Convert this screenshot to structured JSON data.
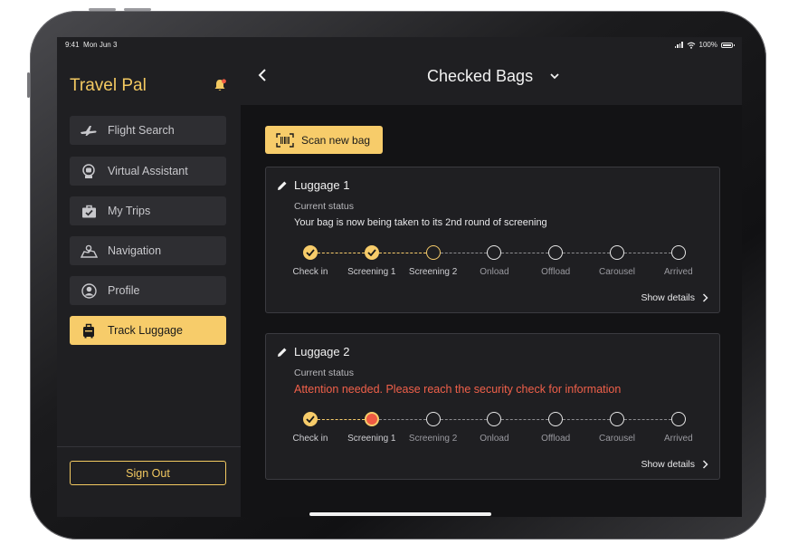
{
  "status_bar": {
    "time": "9:41",
    "date": "Mon Jun 3",
    "battery": "100%"
  },
  "sidebar": {
    "brand": "Travel Pal",
    "items": [
      {
        "label": "Flight Search",
        "icon": "airplane-icon",
        "active": false
      },
      {
        "label": "Virtual Assistant",
        "icon": "assistant-icon",
        "active": false
      },
      {
        "label": "My Trips",
        "icon": "briefcase-icon",
        "active": false
      },
      {
        "label": "Navigation",
        "icon": "map-icon",
        "active": false
      },
      {
        "label": "Profile",
        "icon": "user-icon",
        "active": false
      },
      {
        "label": "Track Luggage",
        "icon": "luggage-icon",
        "active": true
      }
    ],
    "sign_out": "Sign Out"
  },
  "header": {
    "title": "Checked Bags"
  },
  "scan_button": {
    "label": "Scan new bag"
  },
  "bags": [
    {
      "name": "Luggage 1",
      "status_label": "Current status",
      "message": "Your bag is now being taken to its 2nd round of screening",
      "alert": false,
      "steps": [
        {
          "label": "Check in",
          "state": "done"
        },
        {
          "label": "Screening 1",
          "state": "done"
        },
        {
          "label": "Screening 2",
          "state": "current"
        },
        {
          "label": "Onload",
          "state": "pending"
        },
        {
          "label": "Offload",
          "state": "pending"
        },
        {
          "label": "Carousel",
          "state": "pending"
        },
        {
          "label": "Arrived",
          "state": "pending"
        }
      ],
      "details_label": "Show details"
    },
    {
      "name": "Luggage 2",
      "status_label": "Current status",
      "message": "Attention needed. Please reach the security check for information",
      "alert": true,
      "steps": [
        {
          "label": "Check in",
          "state": "done"
        },
        {
          "label": "Screening 1",
          "state": "error"
        },
        {
          "label": "Screening 2",
          "state": "pending"
        },
        {
          "label": "Onload",
          "state": "pending"
        },
        {
          "label": "Offload",
          "state": "pending"
        },
        {
          "label": "Carousel",
          "state": "pending"
        },
        {
          "label": "Arrived",
          "state": "pending"
        }
      ],
      "details_label": "Show details"
    }
  ],
  "colors": {
    "accent": "#f7cc6a",
    "alert": "#f0604a",
    "panel": "#1f1f22",
    "background": "#131315"
  }
}
